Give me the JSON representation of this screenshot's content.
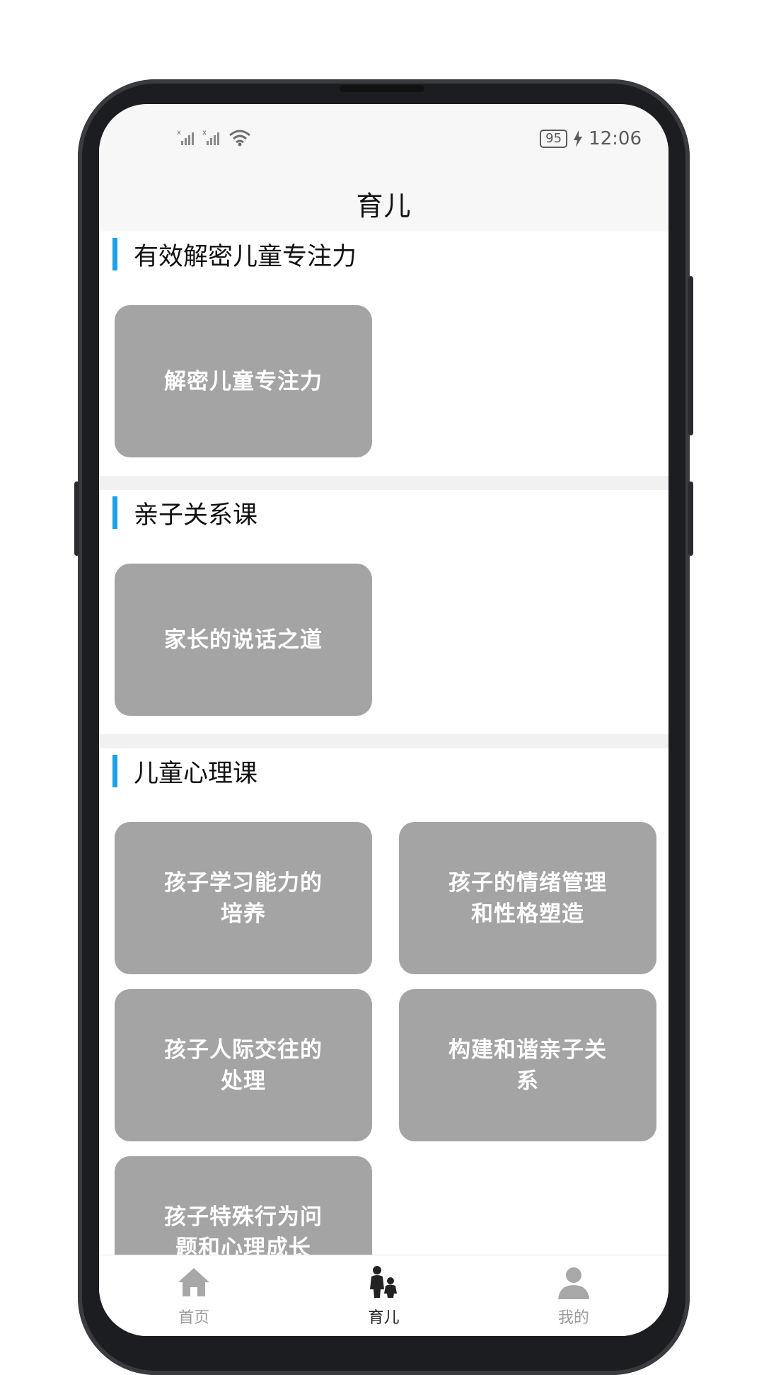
{
  "status_bar": {
    "signal_1": "×📶",
    "signal_2": "×📶",
    "wifi": "wifi",
    "battery": "95",
    "time": "12:06"
  },
  "header": {
    "title": "育儿"
  },
  "sections": [
    {
      "title": "有效解密儿童专注力",
      "cards": [
        "解密儿童专注力"
      ]
    },
    {
      "title": "亲子关系课",
      "cards": [
        "家长的说话之道"
      ]
    },
    {
      "title": "儿童心理课",
      "cards": [
        "孩子学习能力的\n培养",
        "孩子的情绪管理\n和性格塑造",
        "孩子人际交往的\n处理",
        "构建和谐亲子关\n系",
        "孩子特殊行为问\n题和心理成长"
      ]
    }
  ],
  "tabs": [
    {
      "label": "首页",
      "icon": "home-icon"
    },
    {
      "label": "育儿",
      "icon": "parenting-icon",
      "active": true
    },
    {
      "label": "我的",
      "icon": "profile-icon"
    }
  ],
  "colors": {
    "accent": "#1ea0e8",
    "card": "#a4a4a4"
  }
}
